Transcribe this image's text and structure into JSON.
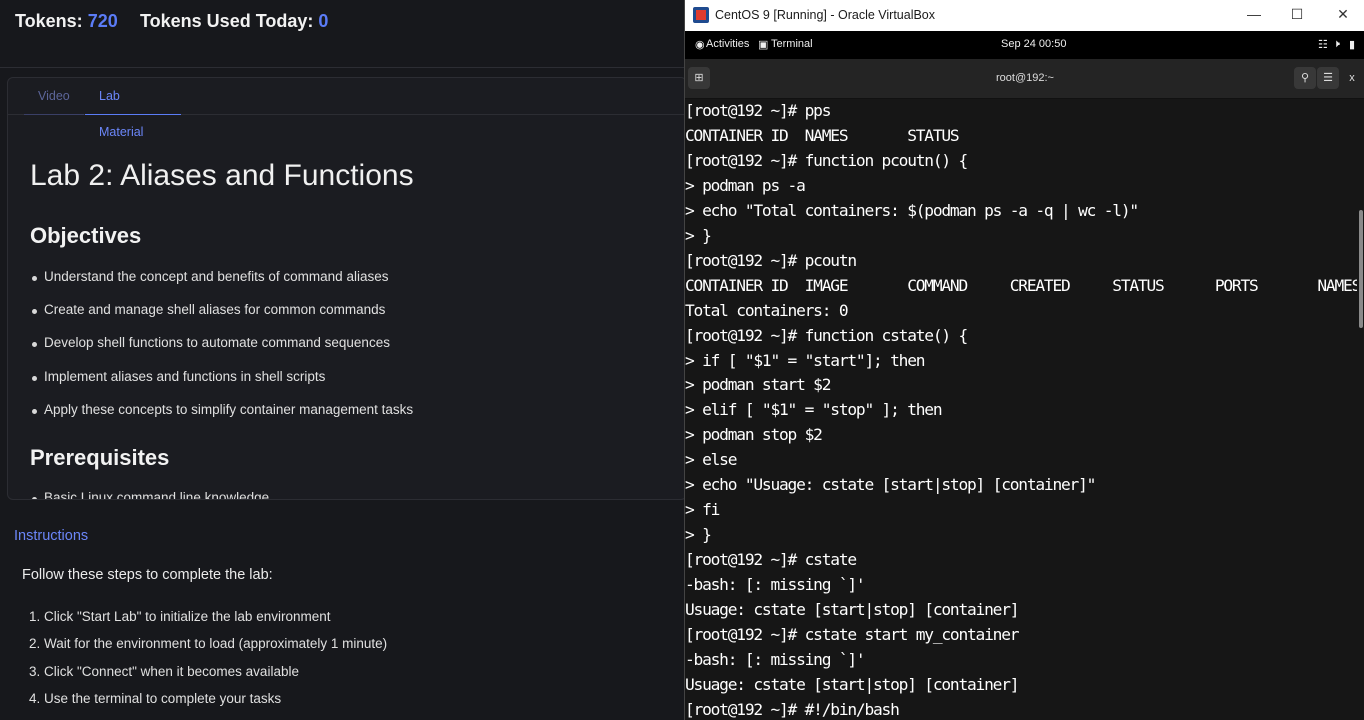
{
  "tokens": {
    "label": "Tokens:",
    "value": "720",
    "used_label": "Tokens Used Today:",
    "used_value": "0"
  },
  "tabs": [
    {
      "label": "Video"
    },
    {
      "label": "Lab Material"
    }
  ],
  "lab": {
    "title": "Lab 2: Aliases and Functions",
    "objectives_heading": "Objectives",
    "objectives": [
      "Understand the concept and benefits of command aliases",
      "Create and manage shell aliases for common commands",
      "Develop shell functions to automate command sequences",
      "Implement aliases and functions in shell scripts",
      "Apply these concepts to simplify container management tasks"
    ],
    "prerequisites_heading": "Prerequisites",
    "prerequisites": [
      "Basic Linux command line knowledge"
    ]
  },
  "instructions": {
    "heading": "Instructions",
    "intro": "Follow these steps to complete the lab:",
    "steps": [
      "1. Click \"Start Lab\" to initialize the lab environment",
      "2. Wait for the environment to load (approximately 1 minute)",
      "3. Click \"Connect\" when it becomes available",
      "4. Use the terminal to complete your tasks"
    ]
  },
  "vbox": {
    "title": "CentOS 9 [Running] - Oracle VirtualBox",
    "activities": "Activities",
    "terminal_app": "Terminal",
    "clock": "Sep 24  00:50",
    "terminal_title": "root@192:~",
    "close_label": "x"
  },
  "terminal_lines": [
    "[root@192 ~]# pps",
    "CONTAINER ID  NAMES       STATUS",
    "[root@192 ~]# function pcoutn() {",
    "> podman ps -a",
    "> echo \"Total containers: $(podman ps -a -q | wc -l)\"",
    "> }",
    "[root@192 ~]# pcoutn",
    "CONTAINER ID  IMAGE       COMMAND     CREATED     STATUS      PORTS       NAMES",
    "Total containers: 0",
    "[root@192 ~]# function cstate() {",
    "> if [ \"$1\" = \"start\"]; then",
    "> podman start $2",
    "> elif [ \"$1\" = \"stop\" ]; then",
    "> podman stop $2",
    "> else",
    "> echo \"Usuage: cstate [start|stop] [container]\"",
    "> fi",
    "> }",
    "[root@192 ~]# cstate",
    "-bash: [: missing `]'",
    "Usuage: cstate [start|stop] [container]",
    "[root@192 ~]# cstate start my_container",
    "-bash: [: missing `]'",
    "Usuage: cstate [start|stop] [container]",
    "[root@192 ~]# #!/bin/bash"
  ]
}
